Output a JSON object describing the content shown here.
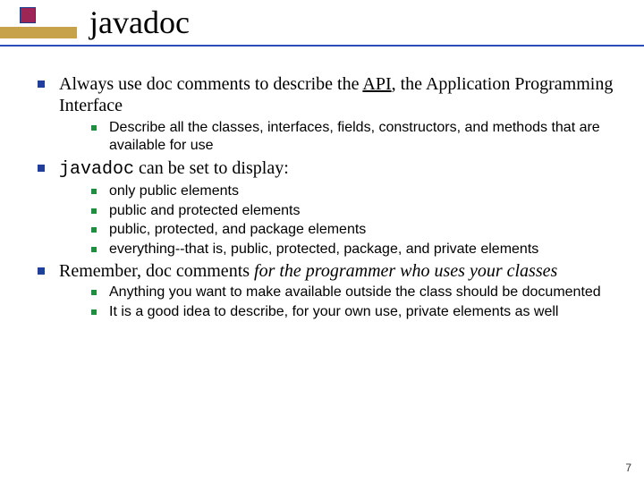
{
  "title": "javadoc",
  "bullets": [
    {
      "prefix": "Always use doc comments to describe the ",
      "link": "API",
      "suffix": ", the Application Programming Interface",
      "sub": [
        "Describe all the classes, interfaces, fields, constructors, and methods that are available for use"
      ]
    },
    {
      "code": "javadoc",
      "rest": " can be set to display:",
      "sub": [
        "only public elements",
        "public and protected elements",
        "public, protected, and package elements",
        "everything--that is, public, protected, package, and private elements"
      ]
    },
    {
      "prefix": "Remember, doc comments ",
      "italic": "for the programmer who uses your classes",
      "sub": [
        "Anything you want to make available outside the class should be documented",
        "It is a good idea to describe, for your own use, private elements as well"
      ]
    }
  ],
  "pagenum": "7"
}
